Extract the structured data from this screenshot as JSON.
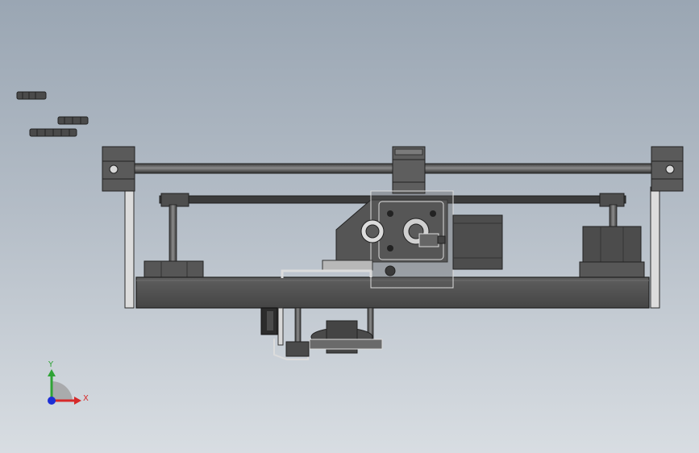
{
  "viewport": {
    "background_top": "#9aa6b3",
    "background_bottom": "#d8dde2"
  },
  "triad": {
    "y_label": "Y",
    "x_label": "X",
    "y_color": "#2fa336",
    "x_color": "#d62a2a",
    "z_color": "#1d2fd6"
  },
  "model": {
    "part_color": "#4d4d4d",
    "dark_color": "#2f2f2f",
    "light_color": "#7a7a7a",
    "rail_color": "#5a5a5a"
  }
}
